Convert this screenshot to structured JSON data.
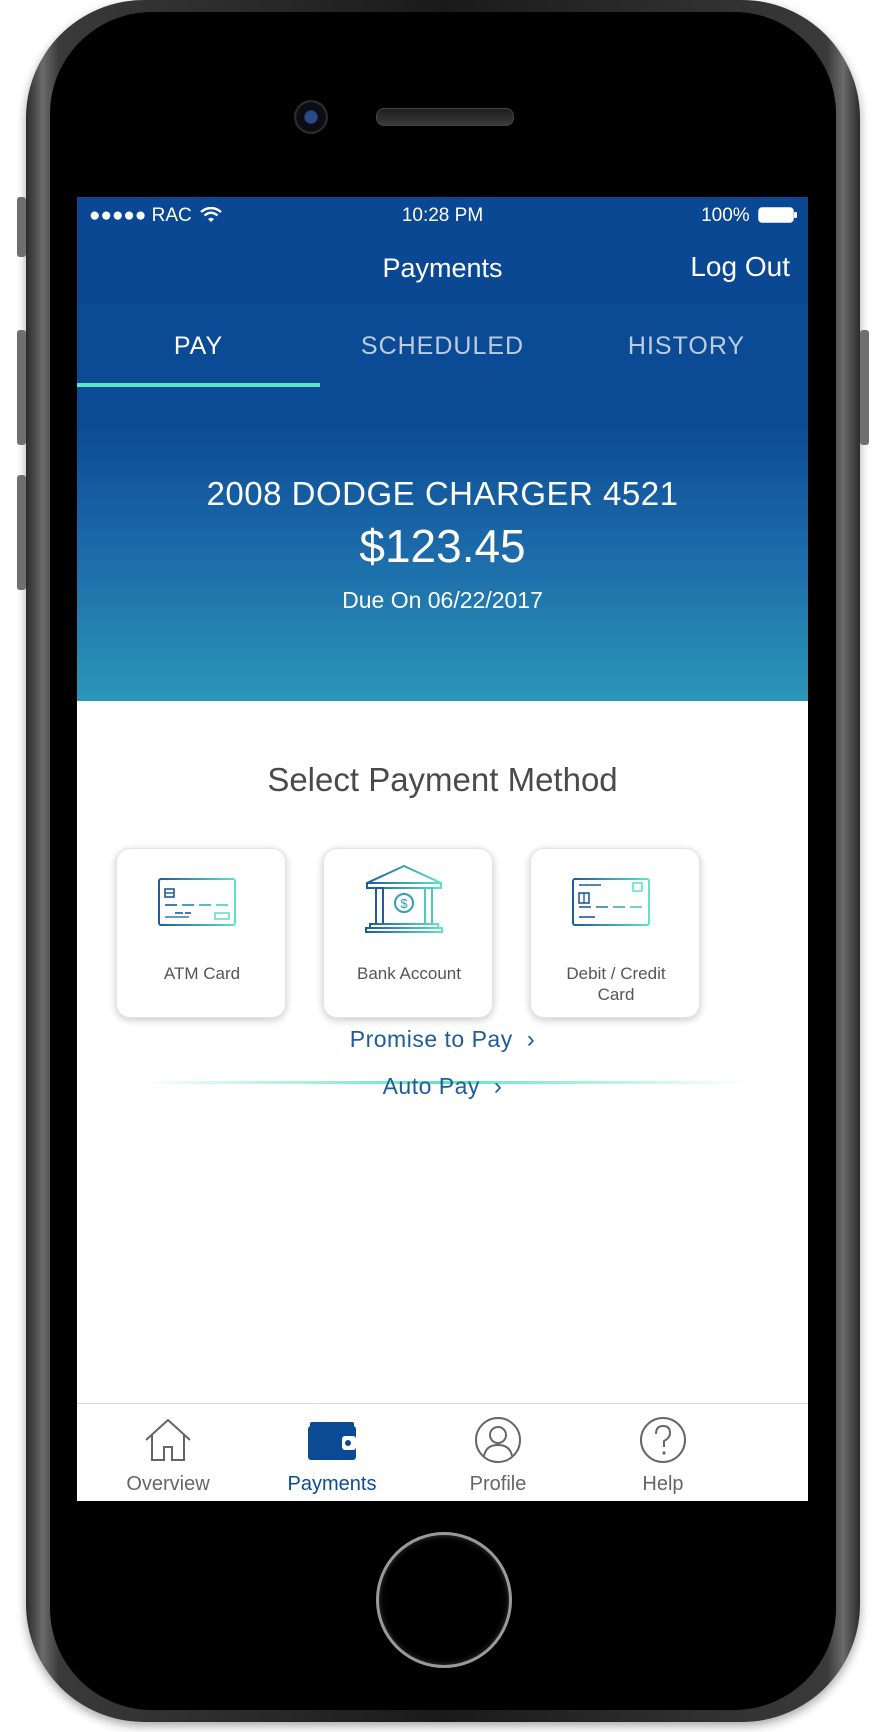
{
  "status_bar": {
    "carrier": "●●●●● RAC",
    "time": "10:28 PM",
    "battery": "100%"
  },
  "header": {
    "title": "Payments",
    "logout_label": "Log Out"
  },
  "tabs": [
    {
      "label": "PAY",
      "active": true
    },
    {
      "label": "SCHEDULED",
      "active": false
    },
    {
      "label": "HISTORY",
      "active": false
    }
  ],
  "account": {
    "vehicle": "2008 DODGE CHARGER 4521",
    "amount": "$123.45",
    "due": "Due On 06/22/2017"
  },
  "payment_methods": {
    "title": "Select Payment Method",
    "options": [
      {
        "label": "ATM Card",
        "icon": "atm-card-icon"
      },
      {
        "label": "Bank Account",
        "icon": "bank-icon"
      },
      {
        "label": "Debit / Credit Card",
        "icon": "credit-card-icon"
      }
    ]
  },
  "links": {
    "promise_to_pay": "Promise to Pay",
    "auto_pay": "Auto Pay"
  },
  "bottom_nav": [
    {
      "label": "Overview",
      "icon": "home-icon",
      "active": false
    },
    {
      "label": "Payments",
      "icon": "wallet-icon",
      "active": true
    },
    {
      "label": "Profile",
      "icon": "profile-icon",
      "active": false
    },
    {
      "label": "Help",
      "icon": "help-icon",
      "active": false
    }
  ],
  "colors": {
    "primary": "#0b4a94",
    "accent": "#5fe3c5",
    "gradient_bottom": "#2a96b6",
    "link": "#1f5c9a"
  }
}
